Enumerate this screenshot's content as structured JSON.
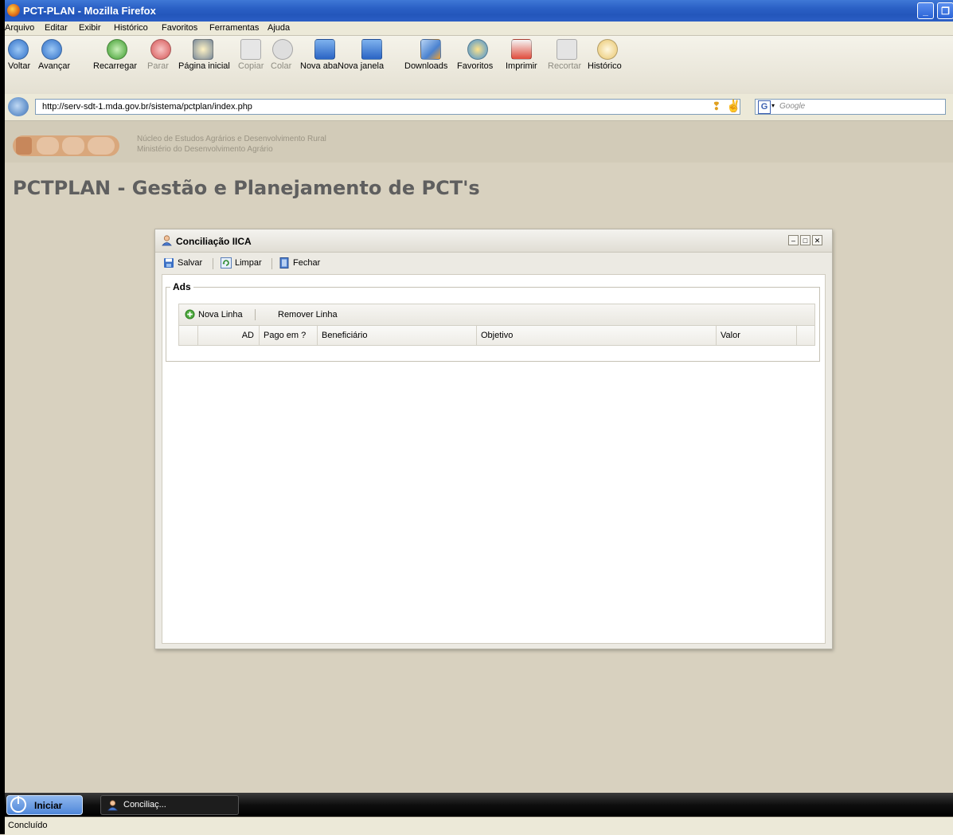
{
  "browser": {
    "title": "PCT-PLAN - Mozilla Firefox",
    "menu": [
      "Arquivo",
      "Editar",
      "Exibir",
      "Histórico",
      "Favoritos",
      "Ferramentas",
      "Ajuda"
    ],
    "toolbar": [
      {
        "label": "Voltar",
        "icon": "back-icon",
        "enabled": true
      },
      {
        "label": "Avançar",
        "icon": "forward-icon",
        "enabled": true
      },
      {
        "label": "Recarregar",
        "icon": "reload-icon",
        "enabled": true
      },
      {
        "label": "Parar",
        "icon": "stop-icon",
        "enabled": false
      },
      {
        "label": "Página inicial",
        "icon": "home-icon",
        "enabled": true
      },
      {
        "label": "Copiar",
        "icon": "copy-icon",
        "enabled": false
      },
      {
        "label": "Colar",
        "icon": "paste-icon",
        "enabled": false
      },
      {
        "label": "Nova aba",
        "icon": "new-tab-icon",
        "enabled": true
      },
      {
        "label": "Nova janela",
        "icon": "new-window-icon",
        "enabled": true
      },
      {
        "label": "Downloads",
        "icon": "downloads-icon",
        "enabled": true
      },
      {
        "label": "Favoritos",
        "icon": "bookmarks-icon",
        "enabled": true
      },
      {
        "label": "Imprimir",
        "icon": "print-icon",
        "enabled": true
      },
      {
        "label": "Recortar",
        "icon": "cut-icon",
        "enabled": false
      },
      {
        "label": "Histórico",
        "icon": "history-icon",
        "enabled": true
      }
    ],
    "url": "http://serv-sdt-1.mda.gov.br/sistema/pctplan/index.php",
    "search_placeholder": "Google",
    "status": "Concluído"
  },
  "page": {
    "logo_text": "nead",
    "org_line1": "Núcleo de Estudos Agrários e Desenvolvimento Rural",
    "org_line2": "Ministério do Desenvolvimento Agrário",
    "title": "PCTPLAN - Gestão e Planejamento de PCT's"
  },
  "window": {
    "title": "Conciliação IICA",
    "tools": {
      "save": "Salvar",
      "clear": "Limpar",
      "close": "Fechar"
    },
    "fieldset_legend": "Ads",
    "grid": {
      "add_row": "Nova Linha",
      "remove_row": "Remover Linha",
      "columns": [
        "AD",
        "Pago em ?",
        "Beneficiário",
        "Objetivo",
        "Valor"
      ]
    }
  },
  "taskbar": {
    "start": "Iniciar",
    "task": "Conciliaç..."
  },
  "colors": {
    "page_bg": "#d8d1bf",
    "title_text": "#5f5f5f",
    "titlebar": "#2356bb"
  }
}
